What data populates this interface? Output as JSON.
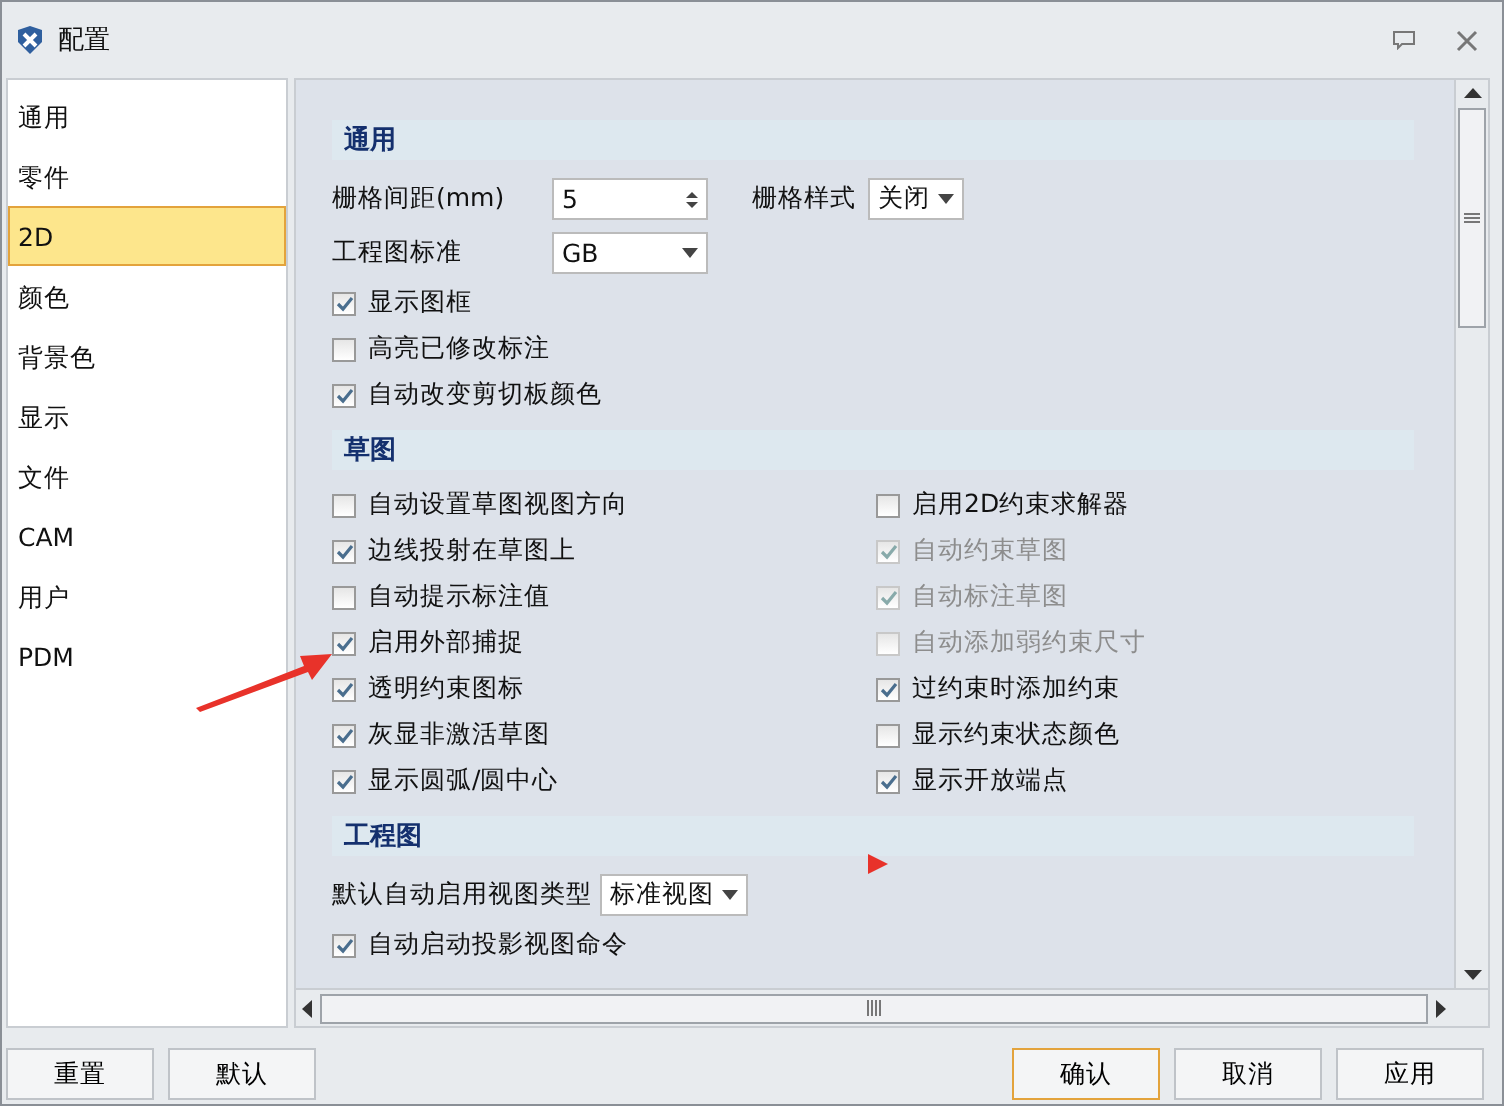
{
  "window": {
    "title": "配置"
  },
  "sidebar": {
    "items": [
      {
        "label": "通用",
        "selected": false
      },
      {
        "label": "零件",
        "selected": false
      },
      {
        "label": "2D",
        "selected": true
      },
      {
        "label": "颜色",
        "selected": false
      },
      {
        "label": "背景色",
        "selected": false
      },
      {
        "label": "显示",
        "selected": false
      },
      {
        "label": "文件",
        "selected": false
      },
      {
        "label": "CAM",
        "selected": false
      },
      {
        "label": "用户",
        "selected": false
      },
      {
        "label": "PDM",
        "selected": false
      }
    ]
  },
  "sections": [
    {
      "title": "通用",
      "rows": [
        [
          {
            "kind": "spin",
            "label": "栅格间距(mm)",
            "value": "5"
          },
          {
            "kind": "dropdown",
            "label": "栅格样式",
            "value": "关闭"
          }
        ],
        [
          {
            "kind": "dropdown",
            "label": "工程图标准",
            "value": "GB"
          }
        ],
        [
          {
            "kind": "checkbox",
            "label": "显示图框",
            "checked": true,
            "disabled": false
          }
        ],
        [
          {
            "kind": "checkbox",
            "label": "高亮已修改标注",
            "checked": false,
            "disabled": false
          }
        ],
        [
          {
            "kind": "checkbox",
            "label": "自动改变剪切板颜色",
            "checked": true,
            "disabled": false
          }
        ]
      ]
    },
    {
      "title": "草图",
      "rows": [
        [
          {
            "kind": "checkbox",
            "label": "自动设置草图视图方向",
            "checked": false,
            "disabled": false
          },
          {
            "kind": "checkbox",
            "label": "启用2D约束求解器",
            "checked": false,
            "disabled": false
          }
        ],
        [
          {
            "kind": "checkbox",
            "label": "边线投射在草图上",
            "checked": true,
            "disabled": false
          },
          {
            "kind": "checkbox",
            "label": "自动约束草图",
            "checked": true,
            "disabled": true
          }
        ],
        [
          {
            "kind": "checkbox",
            "label": "自动提示标注值",
            "checked": false,
            "disabled": false
          },
          {
            "kind": "checkbox",
            "label": "自动标注草图",
            "checked": true,
            "disabled": true
          }
        ],
        [
          {
            "kind": "checkbox",
            "label": "启用外部捕捉",
            "checked": true,
            "disabled": false
          },
          {
            "kind": "checkbox",
            "label": "自动添加弱约束尺寸",
            "checked": false,
            "disabled": true
          }
        ],
        [
          {
            "kind": "checkbox",
            "label": "透明约束图标",
            "checked": true,
            "disabled": false
          },
          {
            "kind": "checkbox",
            "label": "过约束时添加约束",
            "checked": true,
            "disabled": false
          }
        ],
        [
          {
            "kind": "checkbox",
            "label": "灰显非激活草图",
            "checked": true,
            "disabled": false
          },
          {
            "kind": "checkbox",
            "label": "显示约束状态颜色",
            "checked": false,
            "disabled": false
          }
        ],
        [
          {
            "kind": "checkbox",
            "label": "显示圆弧/圆中心",
            "checked": true,
            "disabled": false
          },
          {
            "kind": "checkbox",
            "label": "显示开放端点",
            "checked": true,
            "disabled": false
          }
        ]
      ]
    },
    {
      "title": "工程图",
      "rows": [
        [
          {
            "kind": "dropdown",
            "label": "默认自动启用视图类型",
            "value": "标准视图"
          }
        ],
        [
          {
            "kind": "checkbox",
            "label": "自动启动投影视图命令",
            "checked": true,
            "disabled": false
          }
        ]
      ]
    }
  ],
  "left_buttons": [
    {
      "label": "重置",
      "selected": false
    },
    {
      "label": "默认",
      "selected": false
    }
  ],
  "right_buttons": [
    {
      "label": "确认",
      "selected": true
    },
    {
      "label": "取消",
      "selected": false
    },
    {
      "label": "应用",
      "selected": false
    }
  ]
}
